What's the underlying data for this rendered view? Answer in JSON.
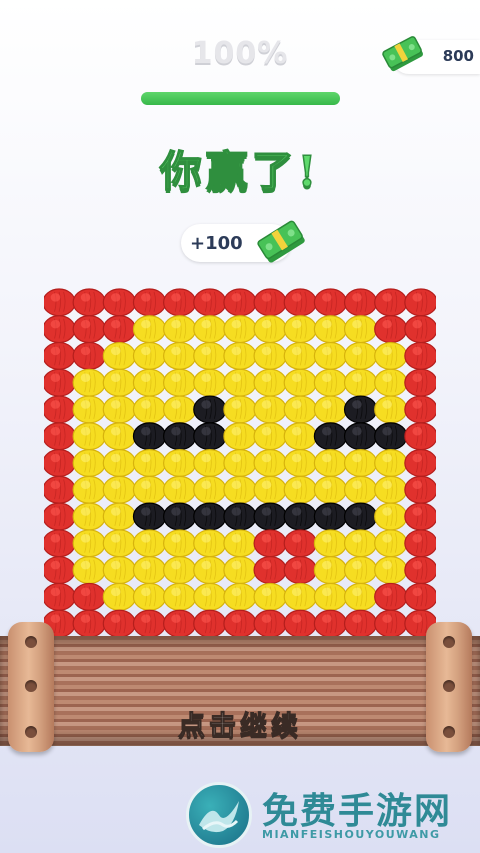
{
  "header": {
    "progress_label": "100%",
    "progress_value": 1.0,
    "currency_value": "800",
    "currency_icon": "cash-stack-icon"
  },
  "win": {
    "title": "你赢了!",
    "reward_label": "+100",
    "reward_icon": "cash-stack-icon"
  },
  "knit": {
    "rows": 13,
    "cols": 13,
    "palette": {
      "R": "#e0312d",
      "Y": "#f6dd21",
      "B": "#1c1c22"
    },
    "pattern": [
      "RRRRRRRRRRRRR",
      "RRRYYYYYYYYRR",
      "RRYYYYYYYYYYR",
      "RYYYYYYYYYYYR",
      "RYYYYBYYYYBYR",
      "RYYBBBYYYBBBR",
      "RYYYYYYYYYYYR",
      "RYYYYYYYYYYYR",
      "RYYBBBBBBBBYR",
      "RYYYYYYRRYYYR",
      "RYYYYYYRRYYYR",
      "RRYYYYYYYYYRR",
      "RRRRRRRRRRRRR"
    ]
  },
  "roller": {
    "continue_label": "点击继续"
  },
  "watermark": {
    "title": "免费手游网",
    "subtitle": "MIANFEISHOUYOUWANG"
  }
}
